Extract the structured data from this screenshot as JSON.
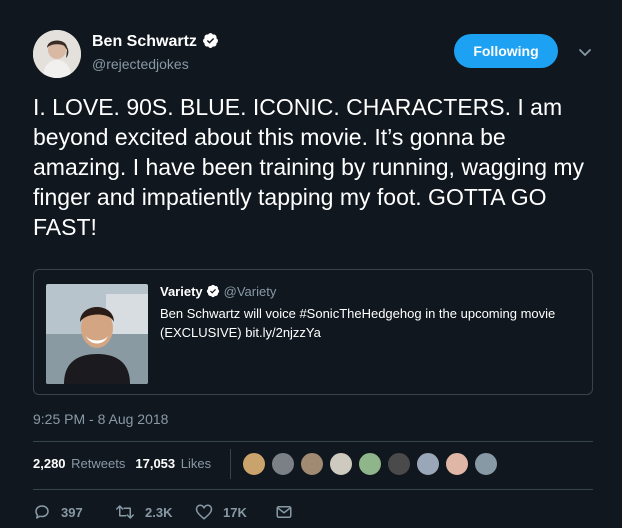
{
  "tweet": {
    "author": {
      "name": "Ben Schwartz",
      "handle": "@rejectedjokes",
      "verified": true,
      "avatar_icon": "profile-photo"
    },
    "follow_label": "Following",
    "text": "I. LOVE. 90S. BLUE. ICONIC. CHARACTERS. I am beyond excited about this movie. It’s gonna be amazing. I have been training by running, wagging my finger and impatiently tapping my foot. GOTTA GO FAST!",
    "quoted": {
      "name": "Variety",
      "handle": "@Variety",
      "verified": true,
      "text": "Ben Schwartz will voice #SonicTheHedgehog in the upcoming movie (EXCLUSIVE) bit.ly/2njzzYa"
    },
    "timestamp": "9:25 PM - 8 Aug 2018",
    "stats": {
      "retweets_count": "2,280",
      "retweets_label": "Retweets",
      "likes_count": "17,053",
      "likes_label": "Likes"
    },
    "liker_avatars": [
      "#c9a36b",
      "#7b7f86",
      "#a08a72",
      "#cfcac0",
      "#8fb58a",
      "#4a4a4a",
      "#9aa7b8",
      "#e0b7a6",
      "#8899a6"
    ],
    "actions": {
      "reply_count": "397",
      "retweet_count": "2.3K",
      "like_count": "17K"
    }
  },
  "colors": {
    "background": "#10171e",
    "accent": "#1da1f2",
    "muted": "#8899a6",
    "border": "#38444d"
  }
}
